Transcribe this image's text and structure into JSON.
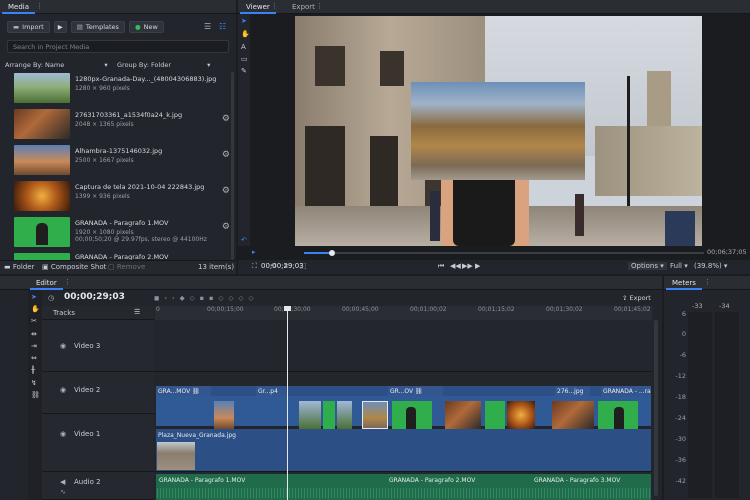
{
  "media": {
    "tab": "Media",
    "import_label": "Import",
    "templates_label": "Templates",
    "new_label": "New",
    "search_placeholder": "Search in Project Media",
    "arrange_label": "Arrange By: Name",
    "group_label": "Group By: Folder",
    "items": [
      {
        "name": "1280px-Granada-Day..._(48004306883).jpg",
        "meta": "1280 × 960 pixels"
      },
      {
        "name": "27631703361_a1534f0a24_k.jpg",
        "meta": "2048 × 1365 pixels"
      },
      {
        "name": "Alhambra-1375146032.jpg",
        "meta": "2500 × 1667 pixels"
      },
      {
        "name": "Captura de tela 2021-10-04 222843.jpg",
        "meta": "1399 × 936 pixels"
      },
      {
        "name": "GRANADA - Paragrafo 1.MOV",
        "meta": "1920 × 1080 pixels\n00;00;50;20 @ 29.97fps, stereo @ 44100Hz"
      },
      {
        "name": "GRANADA - Paragrafo 2.MOV",
        "meta": ""
      }
    ],
    "folder_label": "Folder",
    "composite_label": "Composite Shot",
    "remove_label": "Remove",
    "count_label": "13 item(s)"
  },
  "viewer": {
    "tab_viewer": "Viewer",
    "tab_export": "Export",
    "timecode": "00;00;29;03",
    "end_timecode": "00;06;37;05",
    "options_label": "Options",
    "full_label": "Full",
    "zoom_label": "(39.8%)",
    "playhead_fraction": 0.07
  },
  "editor": {
    "tab": "Editor",
    "timecode": "00;00;29;03",
    "export_label": "Export",
    "tracks_label": "Tracks",
    "ruler": [
      "00;00;15;00",
      "00;00;30;00",
      "00;00;45;00",
      "00;01;00;02",
      "00;01;15;02",
      "00;01;30;02",
      "00;01;45;02"
    ],
    "tracks": [
      {
        "name": "Video 3"
      },
      {
        "name": "Video 2"
      },
      {
        "name": "Video 1"
      },
      {
        "name": "Audio 2"
      }
    ],
    "video2_clips": [
      "GRA...MOV",
      "Gr...p4",
      "GR...OV",
      "276...jpg",
      "GRANADA - ...ra"
    ],
    "video1_clip": "Plaza_Nueva_Granada.jpg",
    "audio_clips": [
      "GRANADA - Paragrafo 1.MOV",
      "GRANADA - Paragrafo 2.MOV",
      "GRANADA - Paragrafo 3.MOV"
    ]
  },
  "meters": {
    "tab": "Meters",
    "channels": [
      "-33",
      "-34"
    ],
    "scale": [
      "6",
      "0",
      "-6",
      "-12",
      "-18",
      "-24",
      "-30",
      "-36",
      "-42"
    ]
  }
}
